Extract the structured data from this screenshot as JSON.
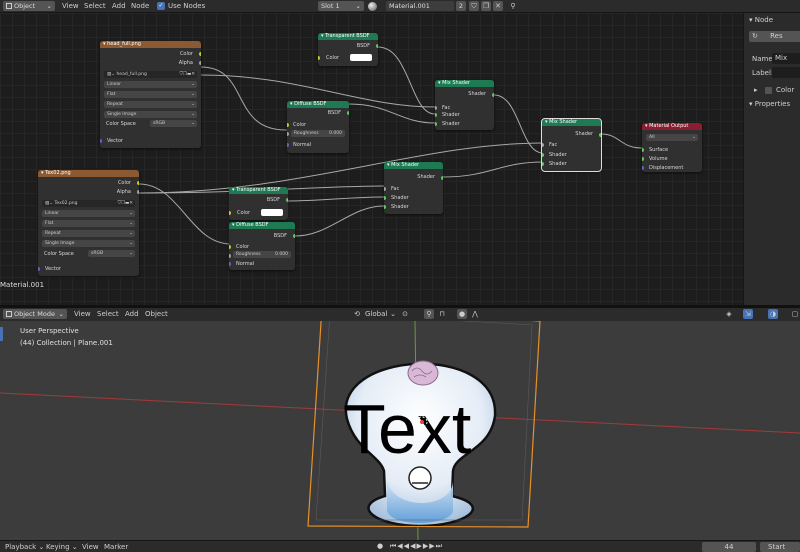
{
  "node_editor_header": {
    "mode": "Object",
    "menus": [
      "View",
      "Select",
      "Add",
      "Node"
    ],
    "use_nodes_label": "Use Nodes",
    "slot": "Slot 1",
    "material": "Material.001",
    "users": "2"
  },
  "nodes": {
    "head_tex": {
      "title": "head_full.png",
      "outputs": [
        "Color",
        "Alpha"
      ],
      "image": "head_full.png",
      "interp": "Linear",
      "proj": "Flat",
      "ext": "Repeat",
      "src": "Single Image",
      "cs_label": "Color Space",
      "cs": "sRGB",
      "input": "Vector"
    },
    "tex02": {
      "title": "Tex02.png",
      "outputs": [
        "Color",
        "Alpha"
      ],
      "image": "Tex02.png",
      "interp": "Linear",
      "proj": "Flat",
      "ext": "Repeat",
      "src": "Single Image",
      "cs_label": "Color Space",
      "cs": "sRGB",
      "input": "Vector"
    },
    "transp1": {
      "title": "Transparent BSDF",
      "output": "BSDF",
      "color": "Color"
    },
    "transp2": {
      "title": "Transparent BSDF",
      "output": "BSDF",
      "color": "Color"
    },
    "diffuse1": {
      "title": "Diffuse BSDF",
      "output": "BSDF",
      "color": "Color",
      "rough_label": "Roughness",
      "rough": "0.000",
      "normal": "Normal"
    },
    "diffuse2": {
      "title": "Diffuse BSDF",
      "output": "BSDF",
      "color": "Color",
      "rough_label": "Roughness",
      "rough": "0.000",
      "normal": "Normal"
    },
    "mix1": {
      "title": "Mix Shader",
      "output": "Shader",
      "fac": "Fac",
      "sh1": "Shader",
      "sh2": "Shader"
    },
    "mix2": {
      "title": "Mix Shader",
      "output": "Shader",
      "fac": "Fac",
      "sh1": "Shader",
      "sh2": "Shader"
    },
    "mix3": {
      "title": "Mix Shader",
      "output": "Shader",
      "fac": "Fac",
      "sh1": "Shader",
      "sh2": "Shader"
    },
    "matout": {
      "title": "Material Output",
      "target": "All",
      "surface": "Surface",
      "volume": "Volume",
      "displacement": "Displacement"
    }
  },
  "editor_material_label": "Material.001",
  "side_panel": {
    "tab": "Node",
    "button": "Res",
    "name_label": "Name:",
    "name_value": "Mix",
    "label_label": "Label:",
    "color_label": "Color",
    "properties_label": "Properties"
  },
  "viewport_header": {
    "mode": "Object Mode",
    "menus": [
      "View",
      "Select",
      "Add",
      "Object"
    ],
    "orientation": "Global"
  },
  "viewport": {
    "perspective": "User Perspective",
    "collection": "(44) Collection | Plane.001",
    "text_object": "Text"
  },
  "timeline": {
    "playback": "Playback",
    "keying": "Keying",
    "view": "View",
    "marker": "Marker",
    "frame": "44",
    "start_label": "Start"
  },
  "colors": {
    "texture_header": "#8b5a33",
    "shader_header": "#1e7a52",
    "output_header": "#8a1d2f",
    "selection": "#e8912b",
    "socket_color": "#c7c729",
    "socket_shader": "#63c763",
    "socket_vector": "#6363c7",
    "socket_float": "#a1a1a1"
  }
}
